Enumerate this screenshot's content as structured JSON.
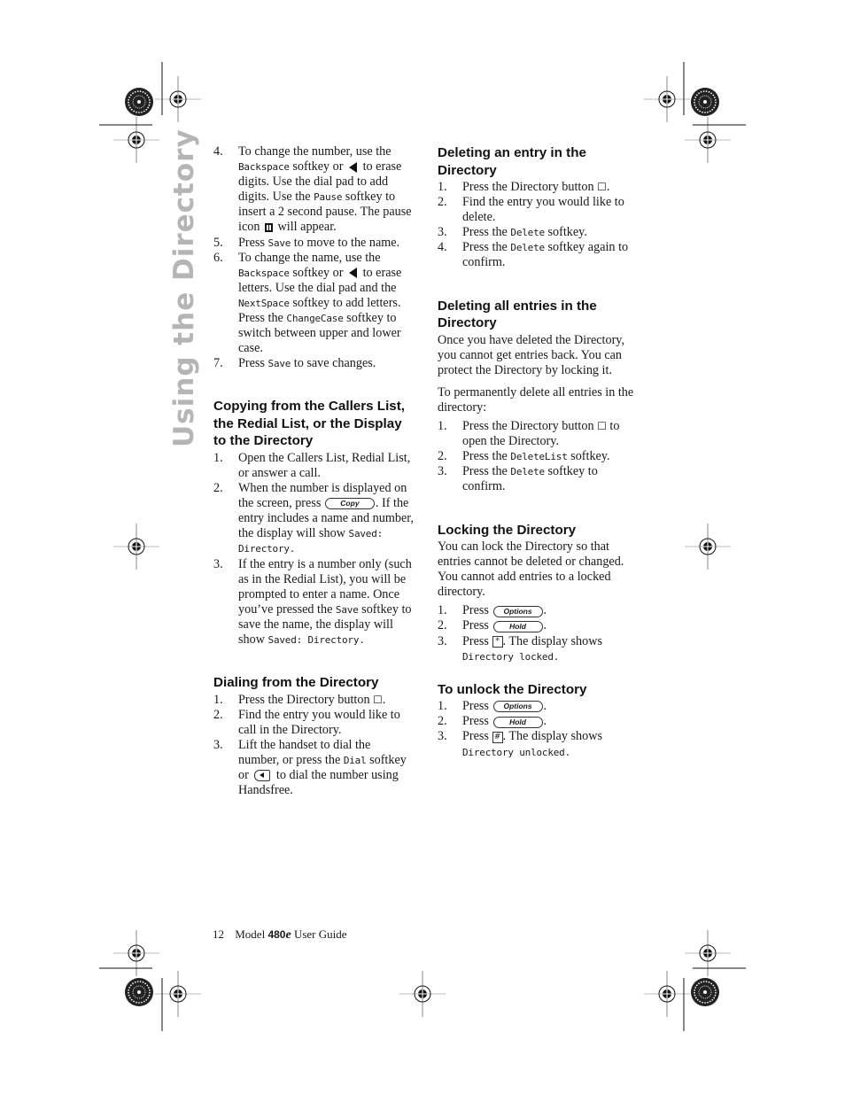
{
  "sidebar_title": "Using the Directory",
  "left_column": {
    "intro_steps": [
      {
        "n": "4.",
        "parts": [
          "To change the number, use the ",
          {
            "mono": "Backspace"
          },
          " softkey or ",
          {
            "icon": "left-arrow"
          },
          " to erase digits. Use the dial pad to add digits. Use the ",
          {
            "mono": "Pause"
          },
          " softkey to insert a 2 second pause. The pause icon ",
          {
            "icon": "pause"
          },
          " will appear."
        ]
      },
      {
        "n": "5.",
        "parts": [
          "Press ",
          {
            "mono": "Save"
          },
          " to move to the name."
        ]
      },
      {
        "n": "6.",
        "parts": [
          "To change the name, use the ",
          {
            "mono": "Backspace"
          },
          " softkey or ",
          {
            "icon": "left-arrow"
          },
          " to erase letters. Use the dial pad and the ",
          {
            "mono": "NextSpace"
          },
          " softkey to add letters. Press the ",
          {
            "mono": "ChangeCase"
          },
          " softkey to switch between upper and lower case."
        ]
      },
      {
        "n": "7.",
        "parts": [
          "Press ",
          {
            "mono": "Save"
          },
          " to save changes."
        ]
      }
    ],
    "copying": {
      "heading": "Copying from the Callers List, the Redial List, or the Display to the Directory",
      "steps": [
        {
          "n": "1.",
          "parts": [
            "Open the Callers List, Redial List, or answer a call."
          ]
        },
        {
          "n": "2.",
          "parts": [
            "When the number is displayed on the screen, press ",
            {
              "softkey": "Copy"
            },
            ". If the entry includes a name and number, the display will show ",
            {
              "mono": "Saved:  Directory."
            }
          ]
        },
        {
          "n": "3.",
          "parts": [
            "If the entry is a number only (such as in the Redial List), you will be prompted to enter a name. Once you’ve pressed the ",
            {
              "mono": "Save"
            },
            " softkey to save the name, the display will show ",
            {
              "mono": "Saved: Directory."
            }
          ]
        }
      ]
    },
    "dialing": {
      "heading": "Dialing from the Directory",
      "steps": [
        {
          "n": "1.",
          "parts": [
            "Press the Directory button ",
            {
              "icon": "book"
            },
            "."
          ]
        },
        {
          "n": "2.",
          "parts": [
            "Find the entry you would like to call in the Directory."
          ]
        },
        {
          "n": "3.",
          "parts": [
            "Lift the handset to dial the number, or press the ",
            {
              "mono": "Dial"
            },
            " softkey or ",
            {
              "icon": "speaker"
            },
            " to dial the number using Handsfree."
          ]
        }
      ]
    }
  },
  "right_column": {
    "deleting_entry": {
      "heading": "Deleting an entry in the Directory",
      "steps": [
        {
          "n": "1.",
          "parts": [
            "Press the Directory button ",
            {
              "icon": "book"
            },
            "."
          ]
        },
        {
          "n": "2.",
          "parts": [
            "Find the entry you would like to delete."
          ]
        },
        {
          "n": "3.",
          "parts": [
            "Press the ",
            {
              "mono": "Delete"
            },
            " softkey."
          ]
        },
        {
          "n": "4.",
          "parts": [
            "Press the ",
            {
              "mono": "Delete"
            },
            " softkey again to confirm."
          ]
        }
      ]
    },
    "deleting_all": {
      "heading": "Deleting all entries in the Directory",
      "paragraphs": [
        "Once you have deleted the Directory, you cannot get entries back. You can protect the Directory by locking it.",
        "To permanently delete all entries in the directory:"
      ],
      "steps": [
        {
          "n": "1.",
          "parts": [
            "Press the Directory button ",
            {
              "icon": "book"
            },
            " to open the Directory."
          ]
        },
        {
          "n": "2.",
          "parts": [
            "Press the ",
            {
              "mono": "DeleteList"
            },
            " softkey."
          ]
        },
        {
          "n": "3.",
          "parts": [
            "Press the ",
            {
              "mono": "Delete"
            },
            " softkey to confirm."
          ]
        }
      ]
    },
    "locking": {
      "heading": "Locking the Directory",
      "paragraph": "You can lock the Directory so that entries cannot be deleted or changed. You cannot add entries to a locked directory.",
      "steps": [
        {
          "n": "1.",
          "parts": [
            "Press ",
            {
              "softkey": "Options"
            },
            "."
          ]
        },
        {
          "n": "2.",
          "parts": [
            "Press ",
            {
              "softkey": "Hold"
            },
            "."
          ]
        },
        {
          "n": "3.",
          "parts": [
            "Press ",
            {
              "key": "*"
            },
            ". The display shows ",
            {
              "mono": "Directory locked."
            }
          ]
        }
      ]
    },
    "unlocking": {
      "heading": "To unlock the Directory",
      "steps": [
        {
          "n": "1.",
          "parts": [
            "Press ",
            {
              "softkey": "Options"
            },
            "."
          ]
        },
        {
          "n": "2.",
          "parts": [
            "Press ",
            {
              "softkey": "Hold"
            },
            "."
          ]
        },
        {
          "n": "3.",
          "parts": [
            "Press ",
            {
              "key": "#"
            },
            ". The display shows ",
            {
              "mono": "Directory unlocked."
            }
          ]
        }
      ]
    }
  },
  "footer": {
    "page_number": "12",
    "model_prefix": "Model",
    "model_number": "480",
    "model_suffix": "e",
    "guide_label": "User Guide"
  }
}
